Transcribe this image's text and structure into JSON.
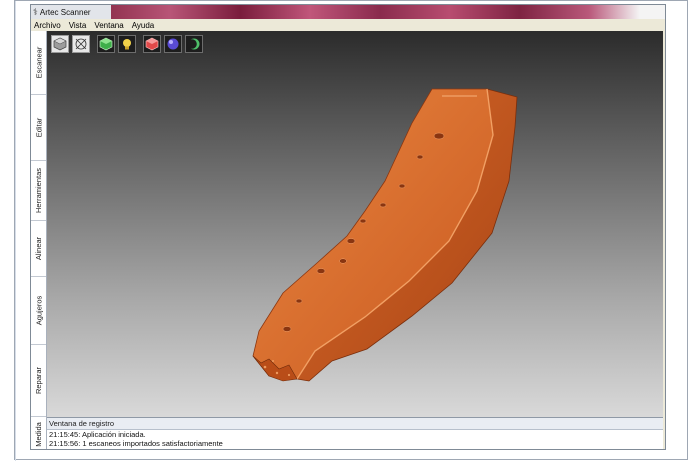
{
  "window": {
    "title": "Artec Scanner"
  },
  "menu": [
    "Archivo",
    "Vista",
    "Ventana",
    "Ayuda"
  ],
  "sidebar": {
    "tabs": [
      {
        "label": "Escanear"
      },
      {
        "label": "Editar"
      },
      {
        "label": "Herramientas"
      },
      {
        "label": "Alinear"
      },
      {
        "label": "Agujeros"
      },
      {
        "label": "Reparar"
      },
      {
        "label": "Medida"
      }
    ]
  },
  "toolbar": {
    "icons": [
      "solid-shading-icon",
      "wireframe-icon",
      "texture-icon",
      "light-bulb-icon",
      "color-cube-icon",
      "sphere-material-icon",
      "crescent-moon-icon"
    ]
  },
  "colors": {
    "model": "#d9692a",
    "title_accent": "#8c2e4a"
  },
  "log": {
    "title": "Ventana de registro",
    "lines": [
      "21:15:45: Aplicación iniciada.",
      "21:15:56: 1 escaneos importados satisfactoriamente"
    ]
  }
}
